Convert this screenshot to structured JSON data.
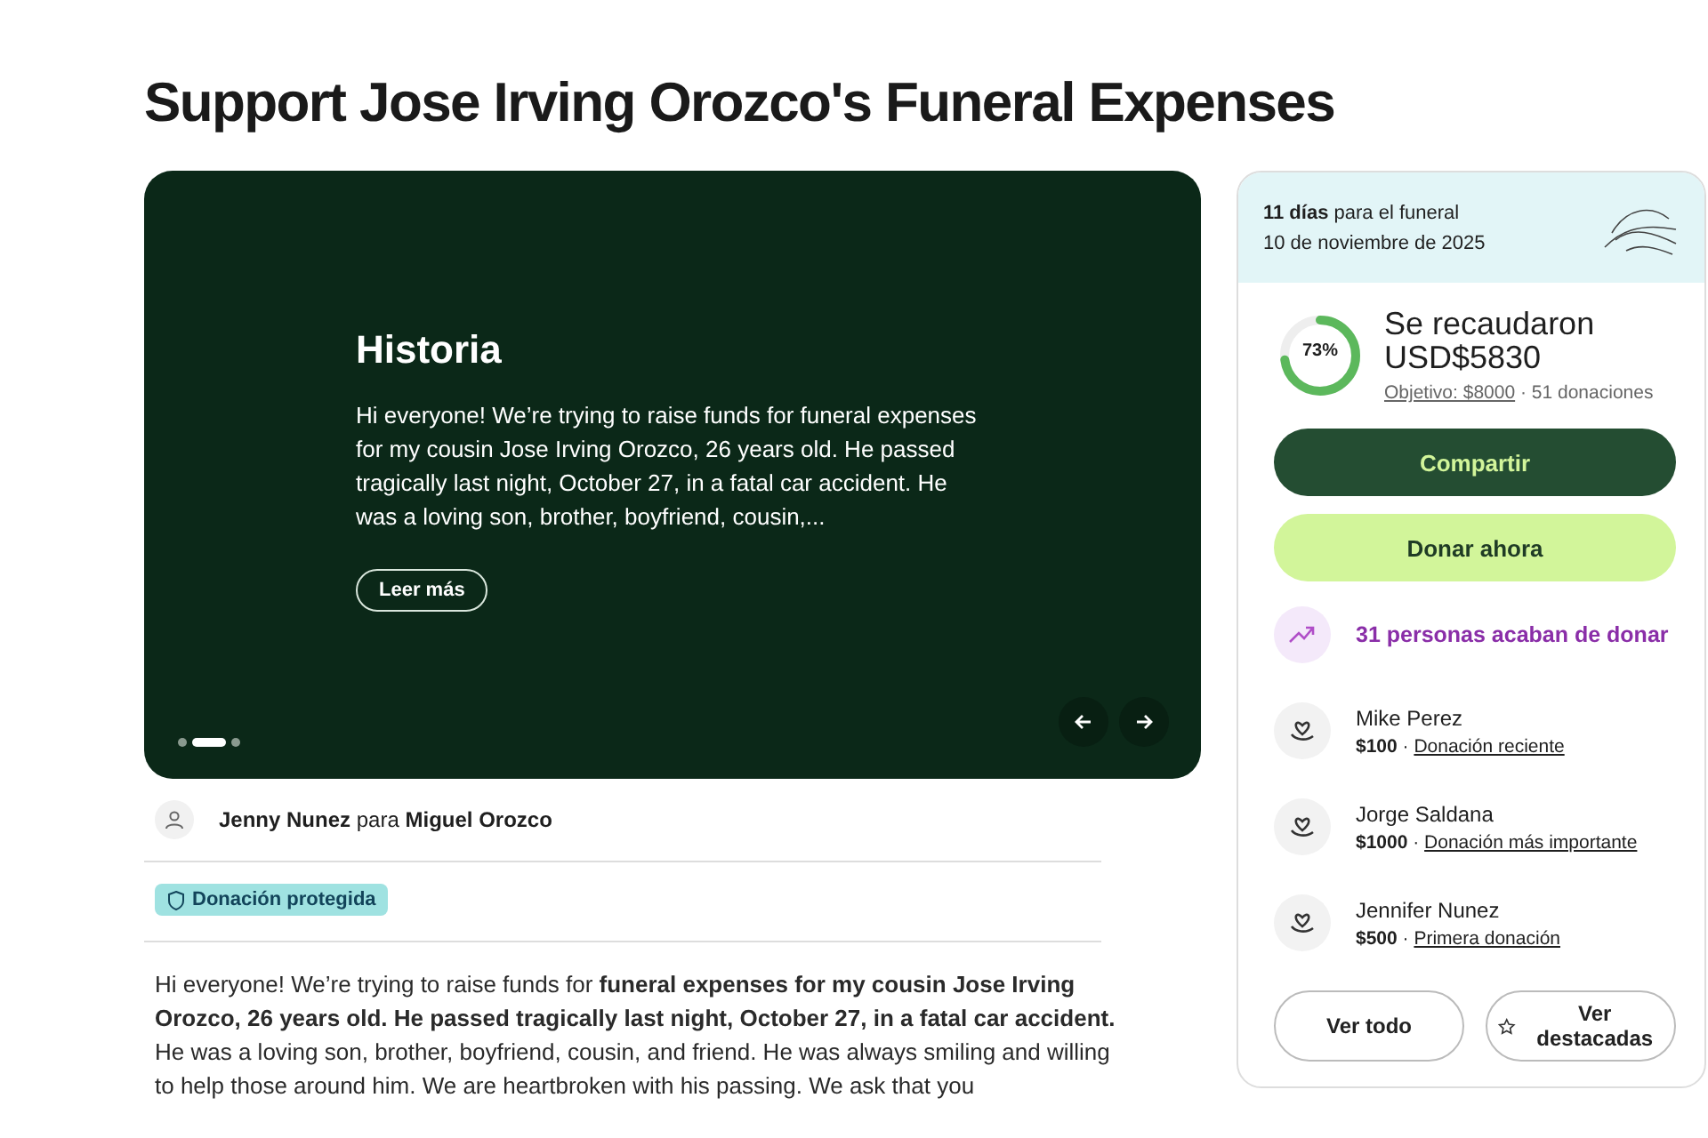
{
  "title": "Support Jose Irving Orozco's Funeral Expenses",
  "story_card": {
    "heading": "Historia",
    "excerpt": "Hi everyone! We’re trying to raise funds for funeral expenses for my cousin Jose Irving Orozco, 26 years old. He passed tragically last night, October 27, in a fatal car accident. He was a loving son, brother, boyfriend, cousin,...",
    "button": "Leer más",
    "dots": [
      {
        "selected": false
      },
      {
        "selected": true
      },
      {
        "selected": false
      }
    ]
  },
  "organizer": {
    "name": "Jenny Nunez",
    "connector": "para",
    "beneficiary": "Miguel Orozco"
  },
  "protection_badge": "Donación protegida",
  "story": "Hi everyone! We’re trying to raise funds for **funeral expenses for my cousin Jose Irving Orozco, 26 years old. He passed tragically last night, October 27, in a fatal car accident.** He was a loving son, brother, boyfriend, cousin, and friend. He was always smiling and willing to help those around him. We are heartbroken with his passing. We ask that you",
  "sidebar": {
    "countdown": "**11 días** para el funeral",
    "date": "10 de noviembre de 2025",
    "progress": {
      "level": 0.73,
      "percent": "73%",
      "raised_label": "Se recaudaron",
      "amount": "USD$5830",
      "goal": "Objetivo: $8000",
      "separator": "·",
      "donations": "51 donaciones"
    },
    "buttons": [
      {
        "label": "Compartir",
        "kind": "dark"
      },
      {
        "label": "Donar ahora",
        "kind": "light"
      }
    ],
    "trend": "31 personas acaban de donar",
    "donors": [
      {
        "name": "Mike Perez",
        "amount": "$100",
        "separator": "·",
        "note": "Donación reciente"
      },
      {
        "name": "Jorge Saldana",
        "amount": "$1000",
        "separator": "·",
        "note": "Donación más importante"
      },
      {
        "name": "Jennifer Nunez",
        "amount": "$500",
        "separator": "·",
        "note": "Primera donación"
      }
    ],
    "footer_buttons": [
      {
        "label": "Ver todo",
        "kind": "plain"
      },
      {
        "label": "Ver destacadas",
        "kind": "star"
      }
    ]
  }
}
